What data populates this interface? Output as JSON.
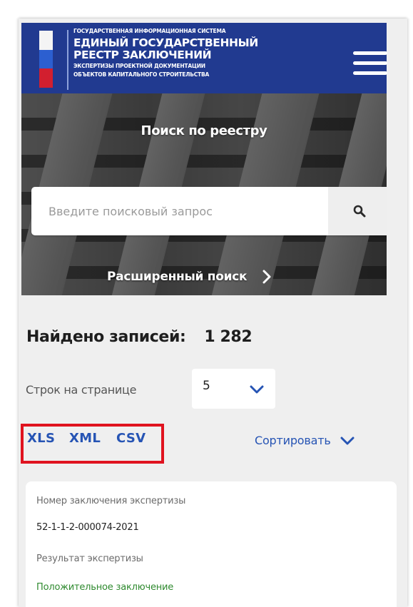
{
  "header": {
    "brand_line1": "Государственная информационная система",
    "brand_line2": "Единый государственный",
    "brand_line3": "реестр заключений",
    "brand_line4": "экспертизы проектной документации",
    "brand_line5": "объектов капитального строительства",
    "menu_icon": "hamburger-menu-icon",
    "bg_color": "#213a90"
  },
  "hero": {
    "title": "Поиск по реестру",
    "search_placeholder": "Введите поисковый запрос",
    "search_icon": "search-icon",
    "advanced_label": "Расширенный поиск",
    "advanced_icon": "chevron-right-icon"
  },
  "results": {
    "found_label": "Найдено записей:",
    "found_count": "1 282",
    "rows_label": "Строк на странице",
    "rows_value": "5",
    "export": {
      "xls": "XLS",
      "xml": "XML",
      "csv": "CSV",
      "highlight_color": "#e0131f"
    },
    "sort_label": "Сортировать",
    "accent_color": "#2654b4"
  },
  "card": {
    "number_label": "Номер заключения экспертизы",
    "number_value": "52-1-1-2-000074-2021",
    "result_label": "Результат экспертизы",
    "result_value": "Положительное заключение",
    "result_color": "#2f8a2f"
  }
}
